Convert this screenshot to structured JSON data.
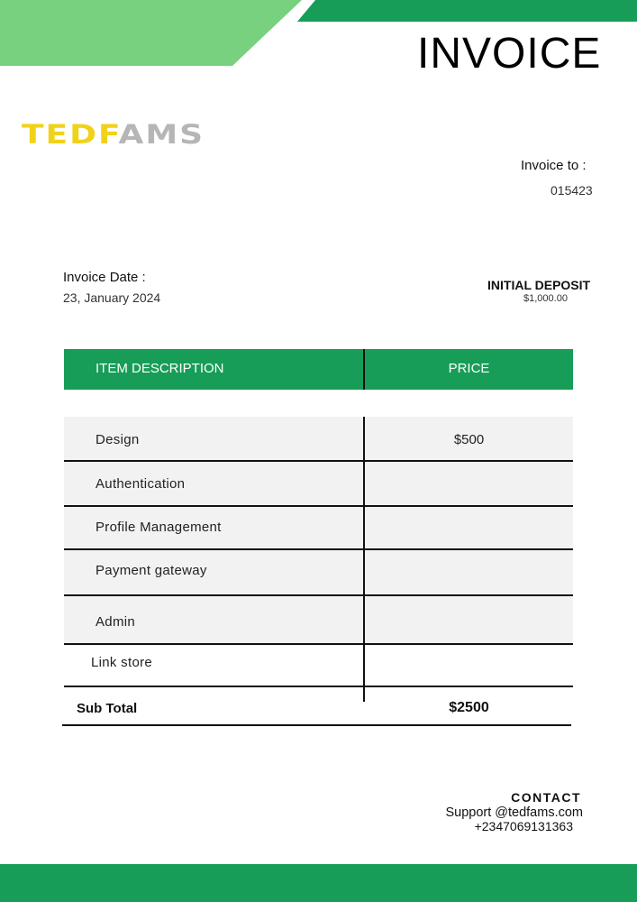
{
  "colors": {
    "green_dark": "#179d57",
    "green_light": "#77d17f",
    "logo_yellow": "#f0d21a",
    "logo_gray": "#b6b6b6"
  },
  "header": {
    "title": "INVOICE"
  },
  "logo": {
    "part1": "TEDF",
    "part2": "AMS"
  },
  "invoice_to": {
    "label": "Invoice to :",
    "value": "015423"
  },
  "invoice_date": {
    "label": "Invoice Date :",
    "value": "23, January 2024"
  },
  "deposit": {
    "label": "INITIAL DEPOSIT",
    "value": "$1,000.00"
  },
  "table": {
    "headers": {
      "description": "ITEM DESCRIPTION",
      "price": "PRICE"
    },
    "rows": [
      {
        "description": "Design",
        "price": "$500"
      },
      {
        "description": "Authentication",
        "price": ""
      },
      {
        "description": "Profile Management",
        "price": ""
      },
      {
        "description": "Payment gateway",
        "price": ""
      },
      {
        "description": "Admin",
        "price": ""
      },
      {
        "description": "Link store",
        "price": ""
      }
    ],
    "subtotal": {
      "label": "Sub Total",
      "value": "$2500"
    }
  },
  "contact": {
    "label": "CONTACT",
    "email": "Support @tedfams.com",
    "phone": "+2347069131363"
  }
}
